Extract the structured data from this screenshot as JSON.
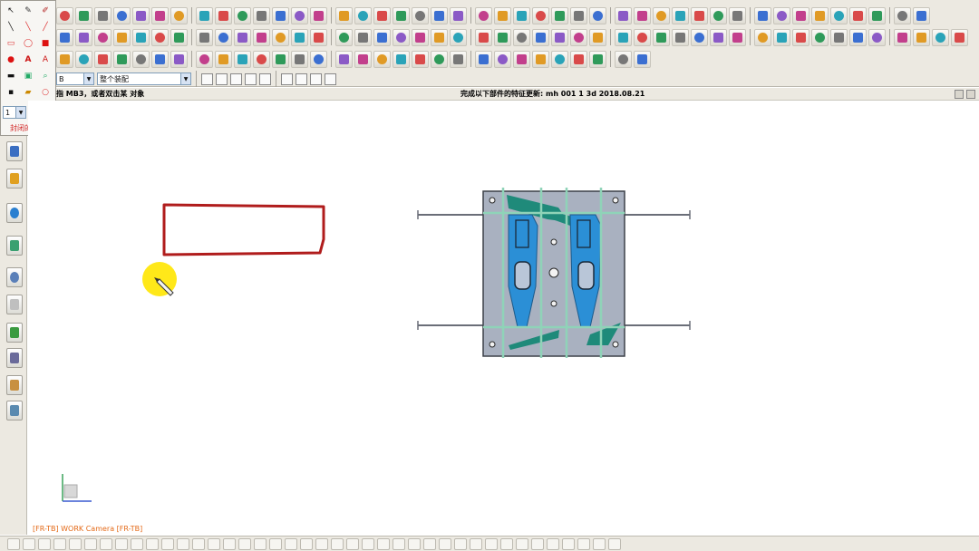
{
  "app": {
    "cue_line": "指 MB3，或者双击某   对象",
    "status_message": "完成以下部件的特征更新: mh 001 1 3d 2018.08.21",
    "viewport_label": "[FR-TB] WORK Camera [FR-TB]"
  },
  "selection_bar": {
    "filter_value": "B",
    "scope_value": "整个装配"
  },
  "palette": {
    "title": "封闭的折线",
    "size_value": "1"
  },
  "colors": {
    "sketch_line": "#b01c1c",
    "mold_plate": "#a9b1c0",
    "cavity_blue": "#2b8fd6",
    "runner_green": "#1f8a7a",
    "cursor_halo": "#ffe600",
    "viewport_label": "#e46a18"
  },
  "icons": {
    "toolbar": [
      "part-icon",
      "assembly-icon",
      "datum-plane-icon",
      "extrude-icon",
      "revolve-icon",
      "hole-icon",
      "chamfer-icon",
      "blend-icon",
      "point-icon",
      "line-icon",
      "arc-icon",
      "circle-icon",
      "fillet-icon",
      "trim-icon",
      "offset-icon",
      "mirror-icon"
    ],
    "left_bar": [
      "resource-bar-icon",
      "history-icon",
      "library-icon",
      "reuse-icon",
      "roles-icon",
      "clock-icon",
      "doc-icon",
      "palette-icon",
      "process-icon",
      "system-icon",
      "screen-icon"
    ],
    "cursor": "pencil-cursor-icon"
  }
}
